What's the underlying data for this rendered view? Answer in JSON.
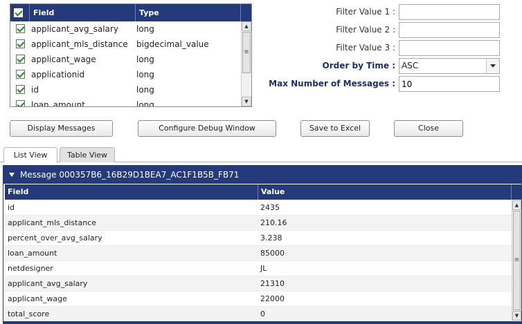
{
  "field_table": {
    "headers": {
      "field": "Field",
      "type": "Type"
    },
    "rows": [
      {
        "field": "applicant_avg_salary",
        "type": "long",
        "checked": true
      },
      {
        "field": "applicant_mls_distance",
        "type": "bigdecimal_value",
        "checked": true
      },
      {
        "field": "applicant_wage",
        "type": "long",
        "checked": true
      },
      {
        "field": "applicationid",
        "type": "long",
        "checked": true
      },
      {
        "field": "id",
        "type": "long",
        "checked": true
      },
      {
        "field": "loan_amount",
        "type": "long",
        "checked": true
      }
    ]
  },
  "filters": {
    "filter1_label": "Filter Value 1 :",
    "filter1_value": "",
    "filter2_label": "Filter Value 2 :",
    "filter2_value": "",
    "filter3_label": "Filter Value 3 :",
    "filter3_value": "",
    "order_label": "Order by Time :",
    "order_value": "ASC",
    "max_label": "Max Number of Messages :",
    "max_value": "10"
  },
  "buttons": {
    "display": "Display Messages",
    "configure": "Configure Debug Window",
    "save": "Save to Excel",
    "close": "Close"
  },
  "tabs": [
    {
      "label": "List View",
      "active": true
    },
    {
      "label": "Table View",
      "active": false
    }
  ],
  "message": {
    "title": "Message 000357B6_16B29D1BEA7_AC1F1B5B_FB71",
    "headers": {
      "field": "Field",
      "value": "Value"
    },
    "rows": [
      {
        "field": "id",
        "value": "2435"
      },
      {
        "field": "applicant_mls_distance",
        "value": "210.16"
      },
      {
        "field": "percent_over_avg_salary",
        "value": "3.238"
      },
      {
        "field": "loan_amount",
        "value": "85000"
      },
      {
        "field": "netdesigner",
        "value": "JL"
      },
      {
        "field": "applicant_avg_salary",
        "value": "21310"
      },
      {
        "field": "applicant_wage",
        "value": "22000"
      },
      {
        "field": "total_score",
        "value": "0"
      }
    ]
  },
  "colors": {
    "header_bg": "#243a7a",
    "check": "#1e8a1e"
  }
}
